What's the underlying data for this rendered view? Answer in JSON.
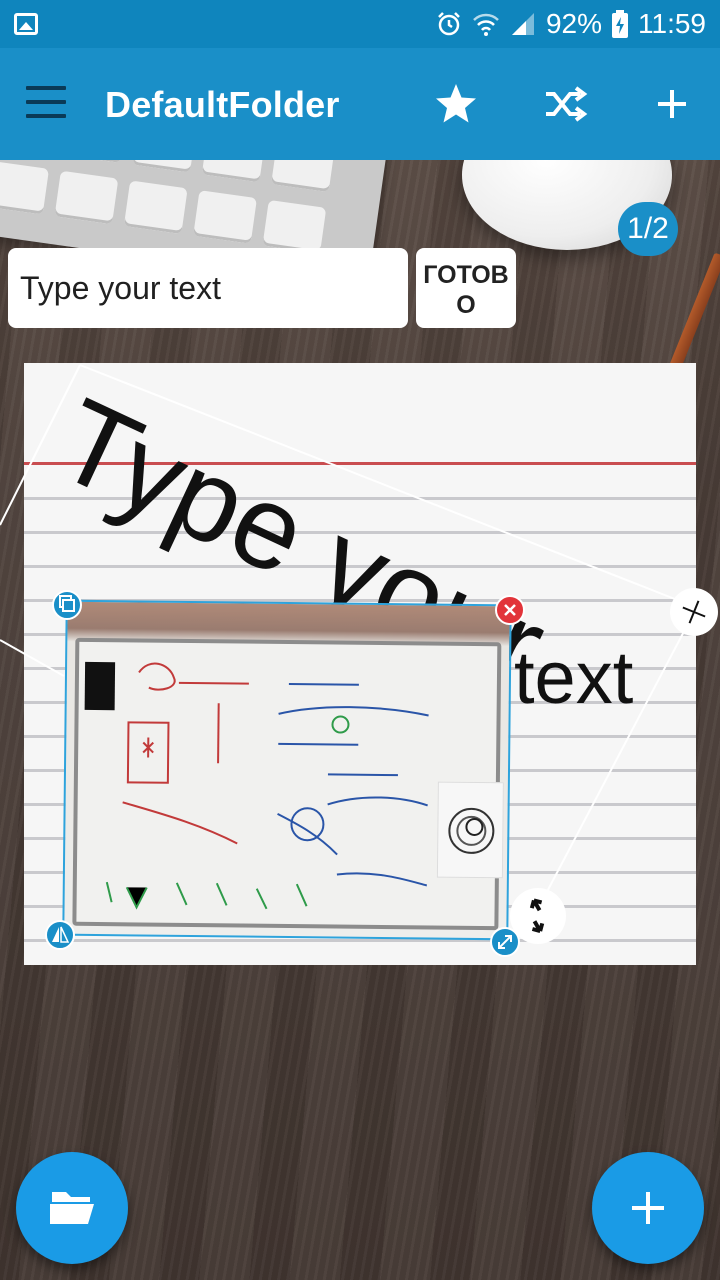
{
  "status_bar": {
    "battery": "92%",
    "time": "11:59"
  },
  "app_bar": {
    "title": "DefaultFolder",
    "icons": [
      "menu-icon",
      "star-icon",
      "shuffle-icon",
      "plus-icon"
    ]
  },
  "page_counter": "1/2",
  "text_input": {
    "value": "Type your text"
  },
  "done_button": {
    "label": "ГОТОВО"
  },
  "canvas": {
    "rotated_text": "Type your",
    "trailing_text": "text"
  },
  "colors": {
    "status_bar": "#0f85bd",
    "app_bar": "#1a8fc8",
    "fab": "#1a9be6",
    "delete_handle": "#e2343a"
  }
}
